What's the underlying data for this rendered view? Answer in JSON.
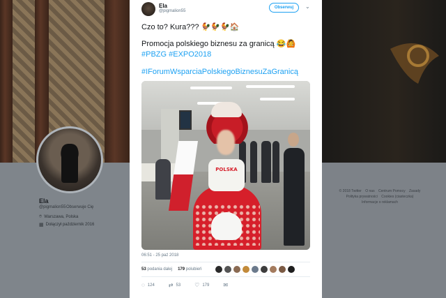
{
  "profile": {
    "name": "Ela",
    "handle": "@pigmalion55",
    "follows_you": "Obserwuje Cię",
    "location": "Warszawa, Polska",
    "joined": "Dołączył październik 2016"
  },
  "footer": {
    "links": [
      "© 2018 Twitter",
      "O nas",
      "Centrum Pomocy",
      "Zasady",
      "Polityka prywatności",
      "Cookies (ciasteczka)",
      "Informacje o reklamach"
    ]
  },
  "tweet": {
    "author_name": "Ela",
    "author_handle": "@pigmalion55",
    "follow_label": "Obserwuj",
    "line1": "Czo to? Kura??? 🐓🐓🐓🏠",
    "line2_text": "Promocja polskiego biznesu za granicą",
    "line2_emoji": "😂🙆",
    "hashtags_line": "#PBZG #EXPO2018",
    "hashtag_long": "#IForumWsparciaPolskiegoBiznesuZaGranicą",
    "photo_caption_text": "POLSKA",
    "timestamp": "06:51 - 25 paź 2018",
    "retweets_count": "53",
    "retweets_label": "podania dalej",
    "likes_count": "179",
    "likes_label": "polubień",
    "reply_count": "124",
    "retweet_action_count": "53",
    "like_action_count": "179"
  },
  "colors": {
    "accent": "#1da1f2",
    "text": "#14171a",
    "muted": "#657786"
  }
}
